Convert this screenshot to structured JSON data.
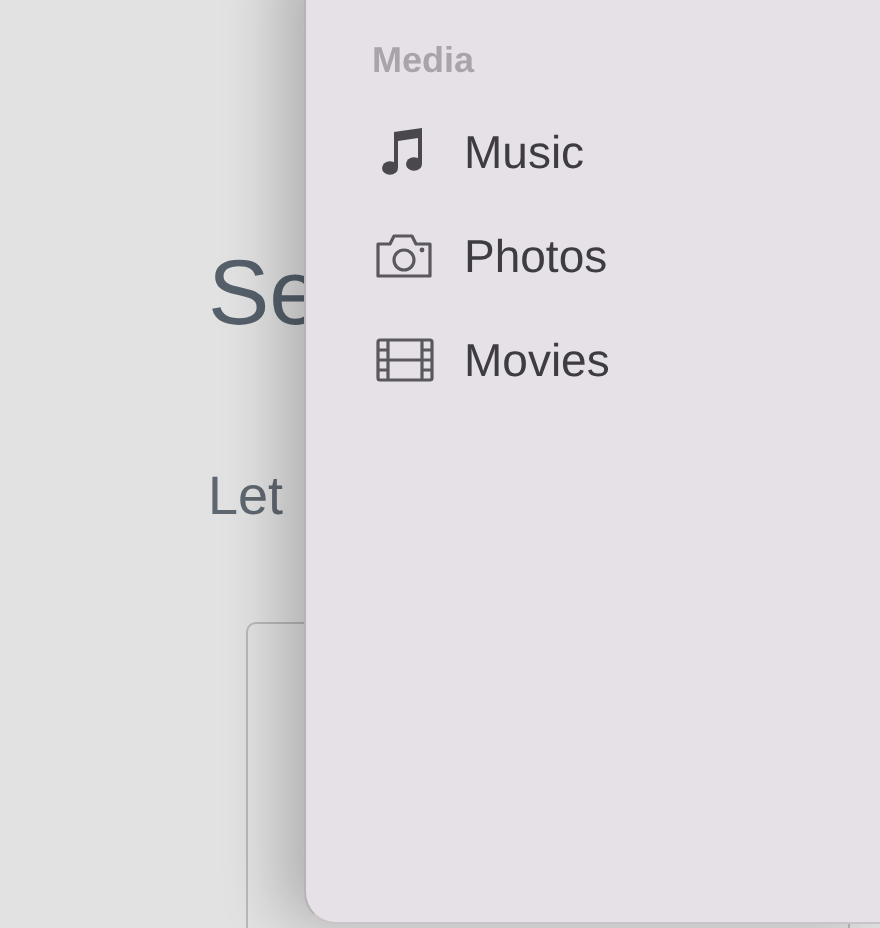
{
  "background": {
    "heading": "Se",
    "subtitle": "Let"
  },
  "drawer": {
    "section": "Media",
    "items": [
      {
        "kind": "music",
        "label": "Music"
      },
      {
        "kind": "photos",
        "label": "Photos"
      },
      {
        "kind": "movies",
        "label": "Movies"
      }
    ]
  }
}
